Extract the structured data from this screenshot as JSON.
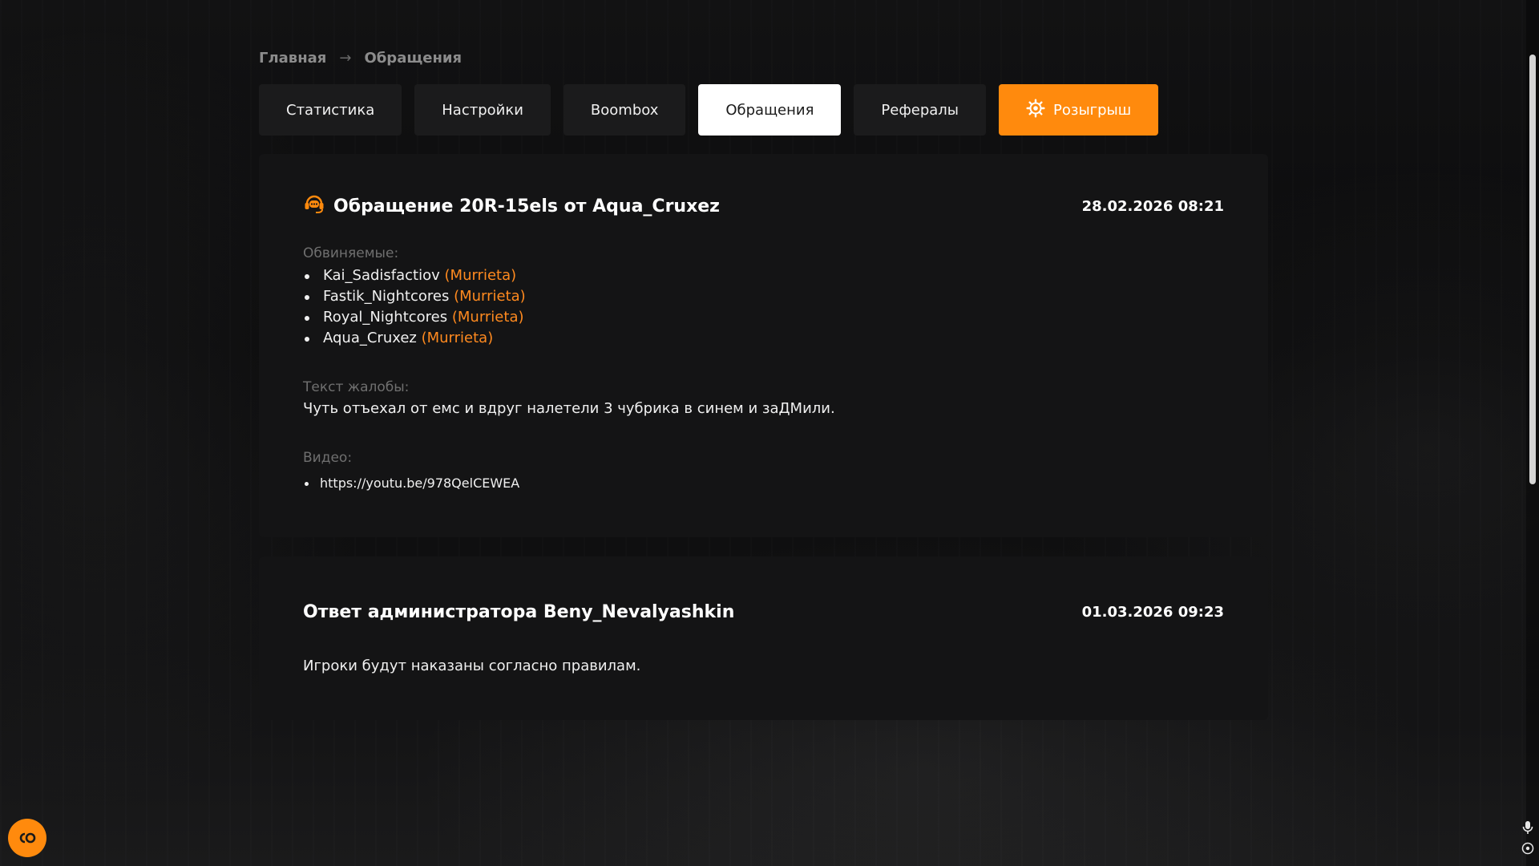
{
  "breadcrumb": {
    "home": "Главная",
    "separator": "→",
    "current": "Обращения"
  },
  "tabs": [
    {
      "label": "Статистика",
      "icon": ""
    },
    {
      "label": "Настройки",
      "icon": ""
    },
    {
      "label": "Boombox",
      "icon": ""
    },
    {
      "label": "Обращения",
      "icon": "",
      "active": true
    },
    {
      "label": "Рефералы",
      "icon": ""
    },
    {
      "label": "Розыгрыш",
      "icon": "gear-sun-icon"
    }
  ],
  "ticket": {
    "icon": "headset-support-icon",
    "title": "Обращение 20R-15els от Aqua_Cruxez",
    "date": "28.02.2026 08:21",
    "accused_label": "Обвиняемые:",
    "accused": [
      {
        "name": "Kai_Sadisfactiov",
        "server": "(Murrieta)"
      },
      {
        "name": "Fastik_Nightcores",
        "server": "(Murrieta)"
      },
      {
        "name": "Royal_Nightcores",
        "server": "(Murrieta)"
      },
      {
        "name": "Aqua_Cruxez",
        "server": "(Murrieta)"
      }
    ],
    "complaint_label": "Текст жалобы:",
    "complaint_text": "Чуть отъехал от емс и вдруг налетели 3 чубрика в синем и заДМили.",
    "video_label": "Видео:",
    "videos": [
      "https://youtu.be/978QelCEWEA"
    ]
  },
  "reply": {
    "title": "Ответ администратора Beny_Nevalyashkin",
    "date": "01.03.2026 09:23",
    "text": "Игроки будут наказаны согласно правилам."
  },
  "colors": {
    "accent": "#ff8a0d",
    "server": "#ff8a1f",
    "card_bg": "#141415",
    "tab_bg": "#1b1b1c"
  },
  "widgets": {
    "chat_icon": "chat-co-icon",
    "mic_icon": "microphone-icon",
    "target_icon": "target-icon"
  }
}
